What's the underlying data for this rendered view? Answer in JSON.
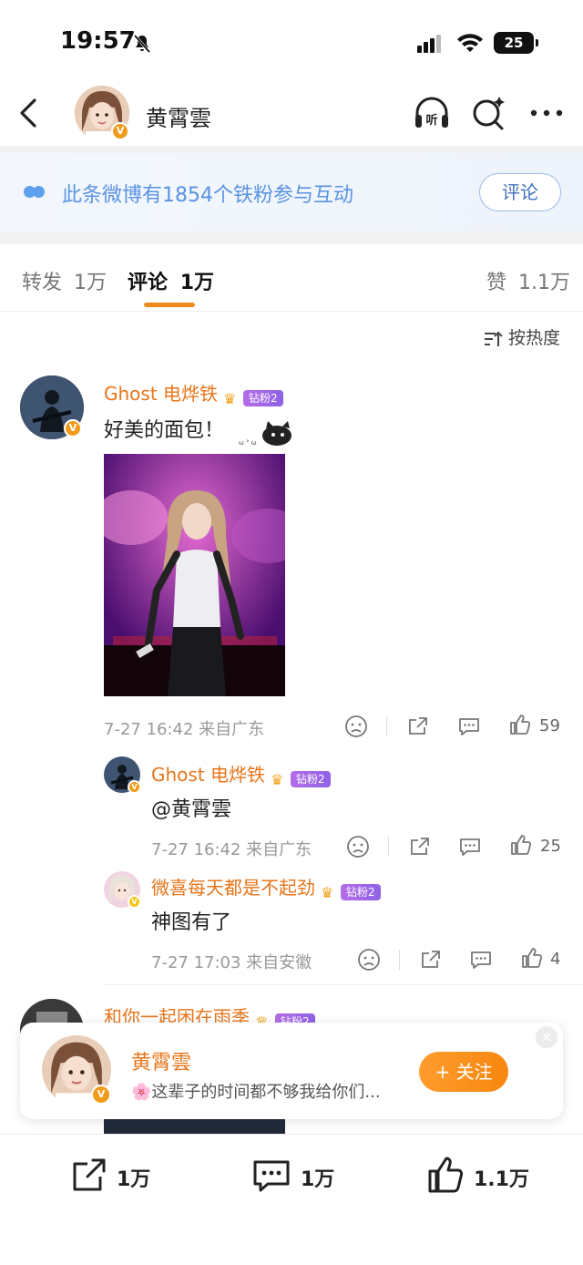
{
  "status_bar": {
    "time": "19:57",
    "battery": "25"
  },
  "header": {
    "name": "黄霄雲"
  },
  "banner": {
    "text": "此条微博有1854个铁粉参与互动",
    "button": "评论"
  },
  "tabs": [
    {
      "label": "转发",
      "count": "1万"
    },
    {
      "label": "评论",
      "count": "1万"
    },
    {
      "label": "赞",
      "count": "1.1万"
    }
  ],
  "sort": {
    "label": "按热度"
  },
  "comments": [
    {
      "nick": "Ghost 电烨铁",
      "badge": "钻粉2",
      "text": "好美的面包！",
      "meta": "7-27 16:42  来自广东",
      "likes": "59"
    }
  ],
  "replies": [
    {
      "nick": "Ghost 电烨铁",
      "badge": "钻粉2",
      "text": "@黄霄雲",
      "meta": "7-27 16:42  来自广东",
      "likes": "25"
    },
    {
      "nick": "微喜每天都是不起劲",
      "badge": "钻粉2",
      "text": "神图有了",
      "meta": "7-27 17:03  来自安徽",
      "likes": "4"
    }
  ],
  "third_comment": {
    "nick": "和你一起困在雨季",
    "badge": "钻粉2"
  },
  "follow_card": {
    "name": "黄霄雲",
    "desc": "🌸这辈子的时间都不够我给你们...",
    "button": "+ 关注"
  },
  "bottom_bar": {
    "repost": "1万",
    "comment": "1万",
    "like": "1.1万"
  }
}
